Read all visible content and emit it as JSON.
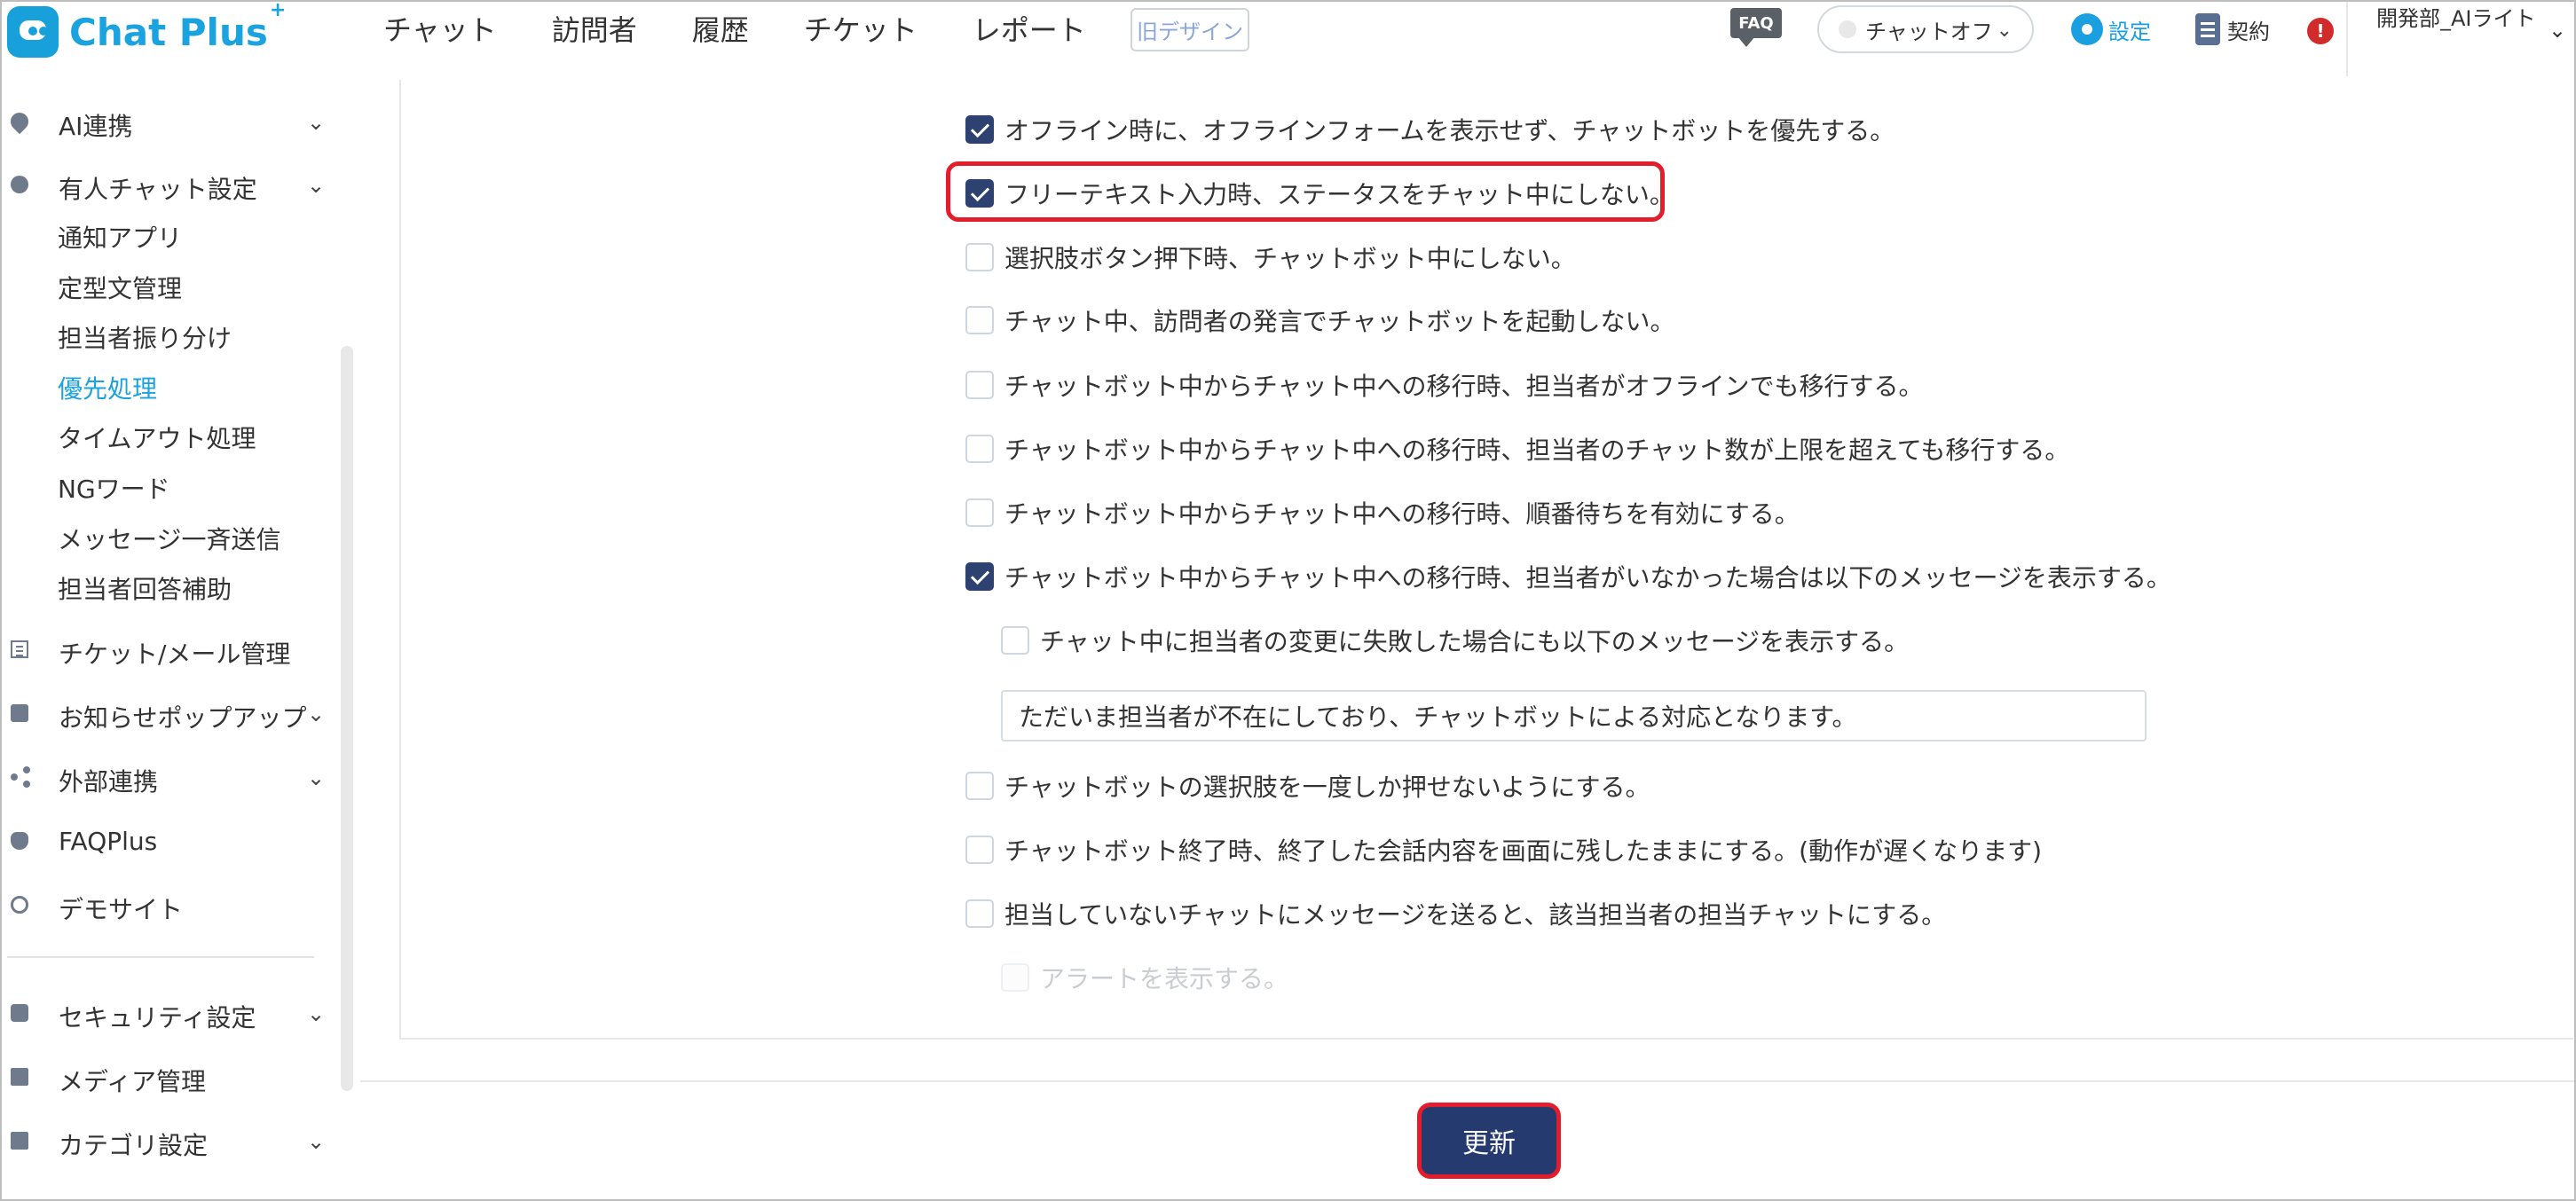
{
  "app": {
    "logo_text": "Chat Plus",
    "logo_sup": "+"
  },
  "header": {
    "nav": [
      "チャット",
      "訪問者",
      "履歴",
      "チケット",
      "レポート"
    ],
    "old_design": "旧デザイン",
    "faq_icon": "FAQ",
    "chat_status": "チャットオフ",
    "settings": "設定",
    "contract": "契約",
    "user_name": "開発部_AIライト"
  },
  "sidebar": {
    "items": [
      {
        "label": "AI連携",
        "icon": "pin-icon"
      },
      {
        "label": "有人チャット設定",
        "icon": "person-icon"
      },
      {
        "label": "通知アプリ",
        "icon": ""
      },
      {
        "label": "定型文管理",
        "icon": ""
      },
      {
        "label": "担当者振り分け",
        "icon": ""
      },
      {
        "label": "優先処理",
        "icon": ""
      },
      {
        "label": "タイムアウト処理",
        "icon": ""
      },
      {
        "label": "NGワード",
        "icon": ""
      },
      {
        "label": "メッセージ一斉送信",
        "icon": ""
      },
      {
        "label": "担当者回答補助",
        "icon": ""
      },
      {
        "label": "チケット/メール管理",
        "icon": "list-icon"
      },
      {
        "label": "お知らせポップアップ",
        "icon": "popup-icon"
      },
      {
        "label": "外部連携",
        "icon": "share-icon"
      },
      {
        "label": "FAQPlus",
        "icon": "shield-icon"
      },
      {
        "label": "デモサイト",
        "icon": "eye-icon"
      },
      {
        "label": "セキュリティ設定",
        "icon": "gear-small-icon"
      },
      {
        "label": "メディア管理",
        "icon": "image-icon"
      },
      {
        "label": "カテゴリ設定",
        "icon": "folder-icon"
      }
    ]
  },
  "options": [
    {
      "label": "オフライン時に、オフラインフォームを表示せず、チャットボットを優先する。",
      "checked": true
    },
    {
      "label": "フリーテキスト入力時、ステータスをチャット中にしない。",
      "checked": true
    },
    {
      "label": "選択肢ボタン押下時、チャットボット中にしない。",
      "checked": false
    },
    {
      "label": "チャット中、訪問者の発言でチャットボットを起動しない。",
      "checked": false
    },
    {
      "label": "チャットボット中からチャット中への移行時、担当者がオフラインでも移行する。",
      "checked": false
    },
    {
      "label": "チャットボット中からチャット中への移行時、担当者のチャット数が上限を超えても移行する。",
      "checked": false
    },
    {
      "label": "チャットボット中からチャット中への移行時、順番待ちを有効にする。",
      "checked": false
    },
    {
      "label": "チャットボット中からチャット中への移行時、担当者がいなかった場合は以下のメッセージを表示する。",
      "checked": true
    },
    {
      "label": "チャット中に担当者の変更に失敗した場合にも以下のメッセージを表示する。",
      "checked": false
    },
    {
      "label": "チャットボットの選択肢を一度しか押せないようにする。",
      "checked": false
    },
    {
      "label": "チャットボット終了時、終了した会話内容を画面に残したままにする。(動作が遅くなります)",
      "checked": false
    },
    {
      "label": "担当していないチャットにメッセージを送ると、該当担当者の担当チャットにする。",
      "checked": false
    },
    {
      "label": "アラートを表示する。",
      "checked": false,
      "disabled": true
    }
  ],
  "fallback_message": "ただいま担当者が不在にしており、チャットボットによる対応となります。",
  "footer": {
    "update_button": "更新"
  },
  "colors": {
    "accent": "#1aa3de",
    "checkbox": "#2d4271",
    "highlight": "#e41d2c",
    "primary_button": "#253b6f"
  }
}
